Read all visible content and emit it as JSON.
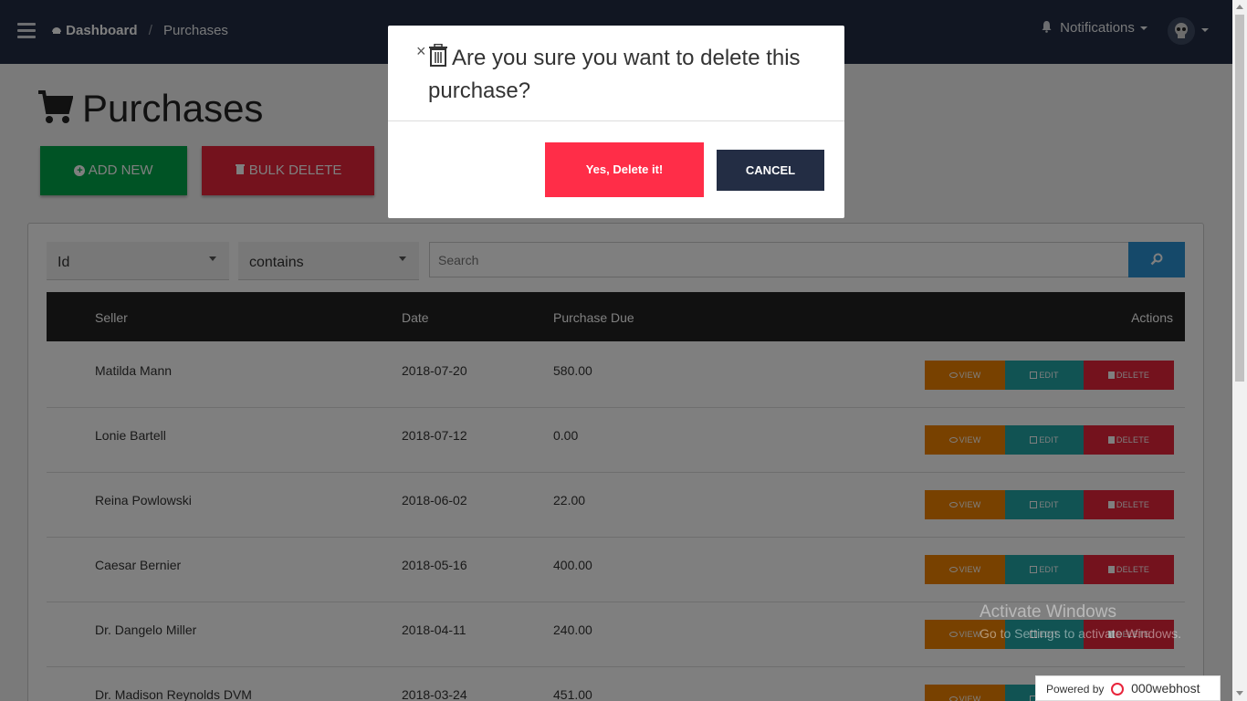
{
  "navbar": {
    "breadcrumb_root": "Dashboard",
    "breadcrumb_sep": "/",
    "breadcrumb_current": "Purchases",
    "notifications_label": "Notifications"
  },
  "page": {
    "title": "Purchases",
    "add_new_label": "ADD NEW",
    "bulk_delete_label": "BULK DELETE"
  },
  "filters": {
    "field_value": "Id",
    "operator_value": "contains",
    "search_placeholder": "Search"
  },
  "table": {
    "headers": {
      "seller": "Seller",
      "date": "Date",
      "due": "Purchase Due",
      "actions": "Actions"
    },
    "action_labels": {
      "view": "VIEW",
      "edit": "EDIT",
      "delete": "DELETE"
    },
    "rows": [
      {
        "seller": "Matilda Mann",
        "date": "2018-07-20",
        "due": "580.00"
      },
      {
        "seller": "Lonie Bartell",
        "date": "2018-07-12",
        "due": "0.00"
      },
      {
        "seller": "Reina Powlowski",
        "date": "2018-06-02",
        "due": "22.00"
      },
      {
        "seller": "Caesar Bernier",
        "date": "2018-05-16",
        "due": "400.00"
      },
      {
        "seller": "Dr. Dangelo Miller",
        "date": "2018-04-11",
        "due": "240.00"
      },
      {
        "seller": "Dr. Madison Reynolds DVM",
        "date": "2018-03-24",
        "due": "451.00"
      }
    ]
  },
  "modal": {
    "close_glyph": "×",
    "title": "Are you sure you want to delete this purchase?",
    "confirm_label": "Yes, Delete it!",
    "cancel_label": "CANCEL"
  },
  "watermark": {
    "line1": "Activate Windows",
    "line2": "Go to Settings to activate Windows."
  },
  "footer_badge": {
    "prefix": "Powered by",
    "brand": "000webhost"
  },
  "colors": {
    "navbar": "#232d44",
    "add_button": "#00a74a",
    "danger": "#e8243b",
    "confirm": "#ff2d48",
    "view": "#f08300",
    "edit": "#22a7a6",
    "search_button": "#2a93d5",
    "table_header": "#222222"
  }
}
